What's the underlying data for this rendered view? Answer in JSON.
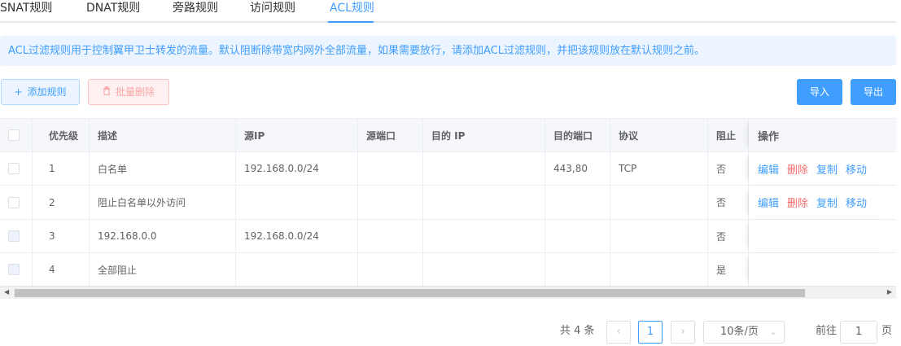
{
  "tabs": [
    {
      "label": "SNAT规则",
      "active": false
    },
    {
      "label": "DNAT规则",
      "active": false
    },
    {
      "label": "旁路规则",
      "active": false
    },
    {
      "label": "访问规则",
      "active": false
    },
    {
      "label": "ACL规则",
      "active": true
    }
  ],
  "alert": "ACL过滤规则用于控制翼甲卫士转发的流量。默认阻断除带宽内网外全部流量，如果需要放行，请添加ACL过滤规则，并把该规则放在默认规则之前。",
  "toolbar": {
    "add_label": "添加规则",
    "batch_delete_label": "批量删除",
    "import_label": "导入",
    "export_label": "导出"
  },
  "table": {
    "columns": [
      "优先级",
      "描述",
      "源IP",
      "源端口",
      "目的 IP",
      "目的端口",
      "协议",
      "阻止",
      "操作"
    ],
    "rows": [
      {
        "priority": "1",
        "desc": "白名单",
        "src_ip": "192.168.0.0/24",
        "src_port": "",
        "dst_ip": "",
        "dst_port": "443,80",
        "protocol": "TCP",
        "block": "否",
        "actions": [
          "编辑",
          "删除",
          "复制",
          "移动"
        ],
        "selectable": true
      },
      {
        "priority": "2",
        "desc": "阻止白名单以外访问",
        "src_ip": "",
        "src_port": "",
        "dst_ip": "",
        "dst_port": "",
        "protocol": "",
        "block": "否",
        "actions": [
          "编辑",
          "删除",
          "复制",
          "移动"
        ],
        "selectable": true
      },
      {
        "priority": "3",
        "desc": "192.168.0.0",
        "src_ip": "192.168.0.0/24",
        "src_port": "",
        "dst_ip": "",
        "dst_port": "",
        "protocol": "",
        "block": "否",
        "actions": [],
        "selectable": false
      },
      {
        "priority": "4",
        "desc": "全部阻止",
        "src_ip": "",
        "src_port": "",
        "dst_ip": "",
        "dst_port": "",
        "protocol": "",
        "block": "是",
        "actions": [],
        "selectable": false
      }
    ]
  },
  "pagination": {
    "total": "共 4 条",
    "current_page": "1",
    "page_size": "10条/页",
    "goto_prefix": "前往",
    "goto_value": "1",
    "goto_suffix": "页"
  },
  "colors": {
    "primary": "#409eff",
    "danger": "#f56c6c"
  },
  "icons": {
    "add": "plus-icon",
    "delete": "trash-icon",
    "prev": "chevron-left-icon",
    "next": "chevron-right-icon"
  }
}
